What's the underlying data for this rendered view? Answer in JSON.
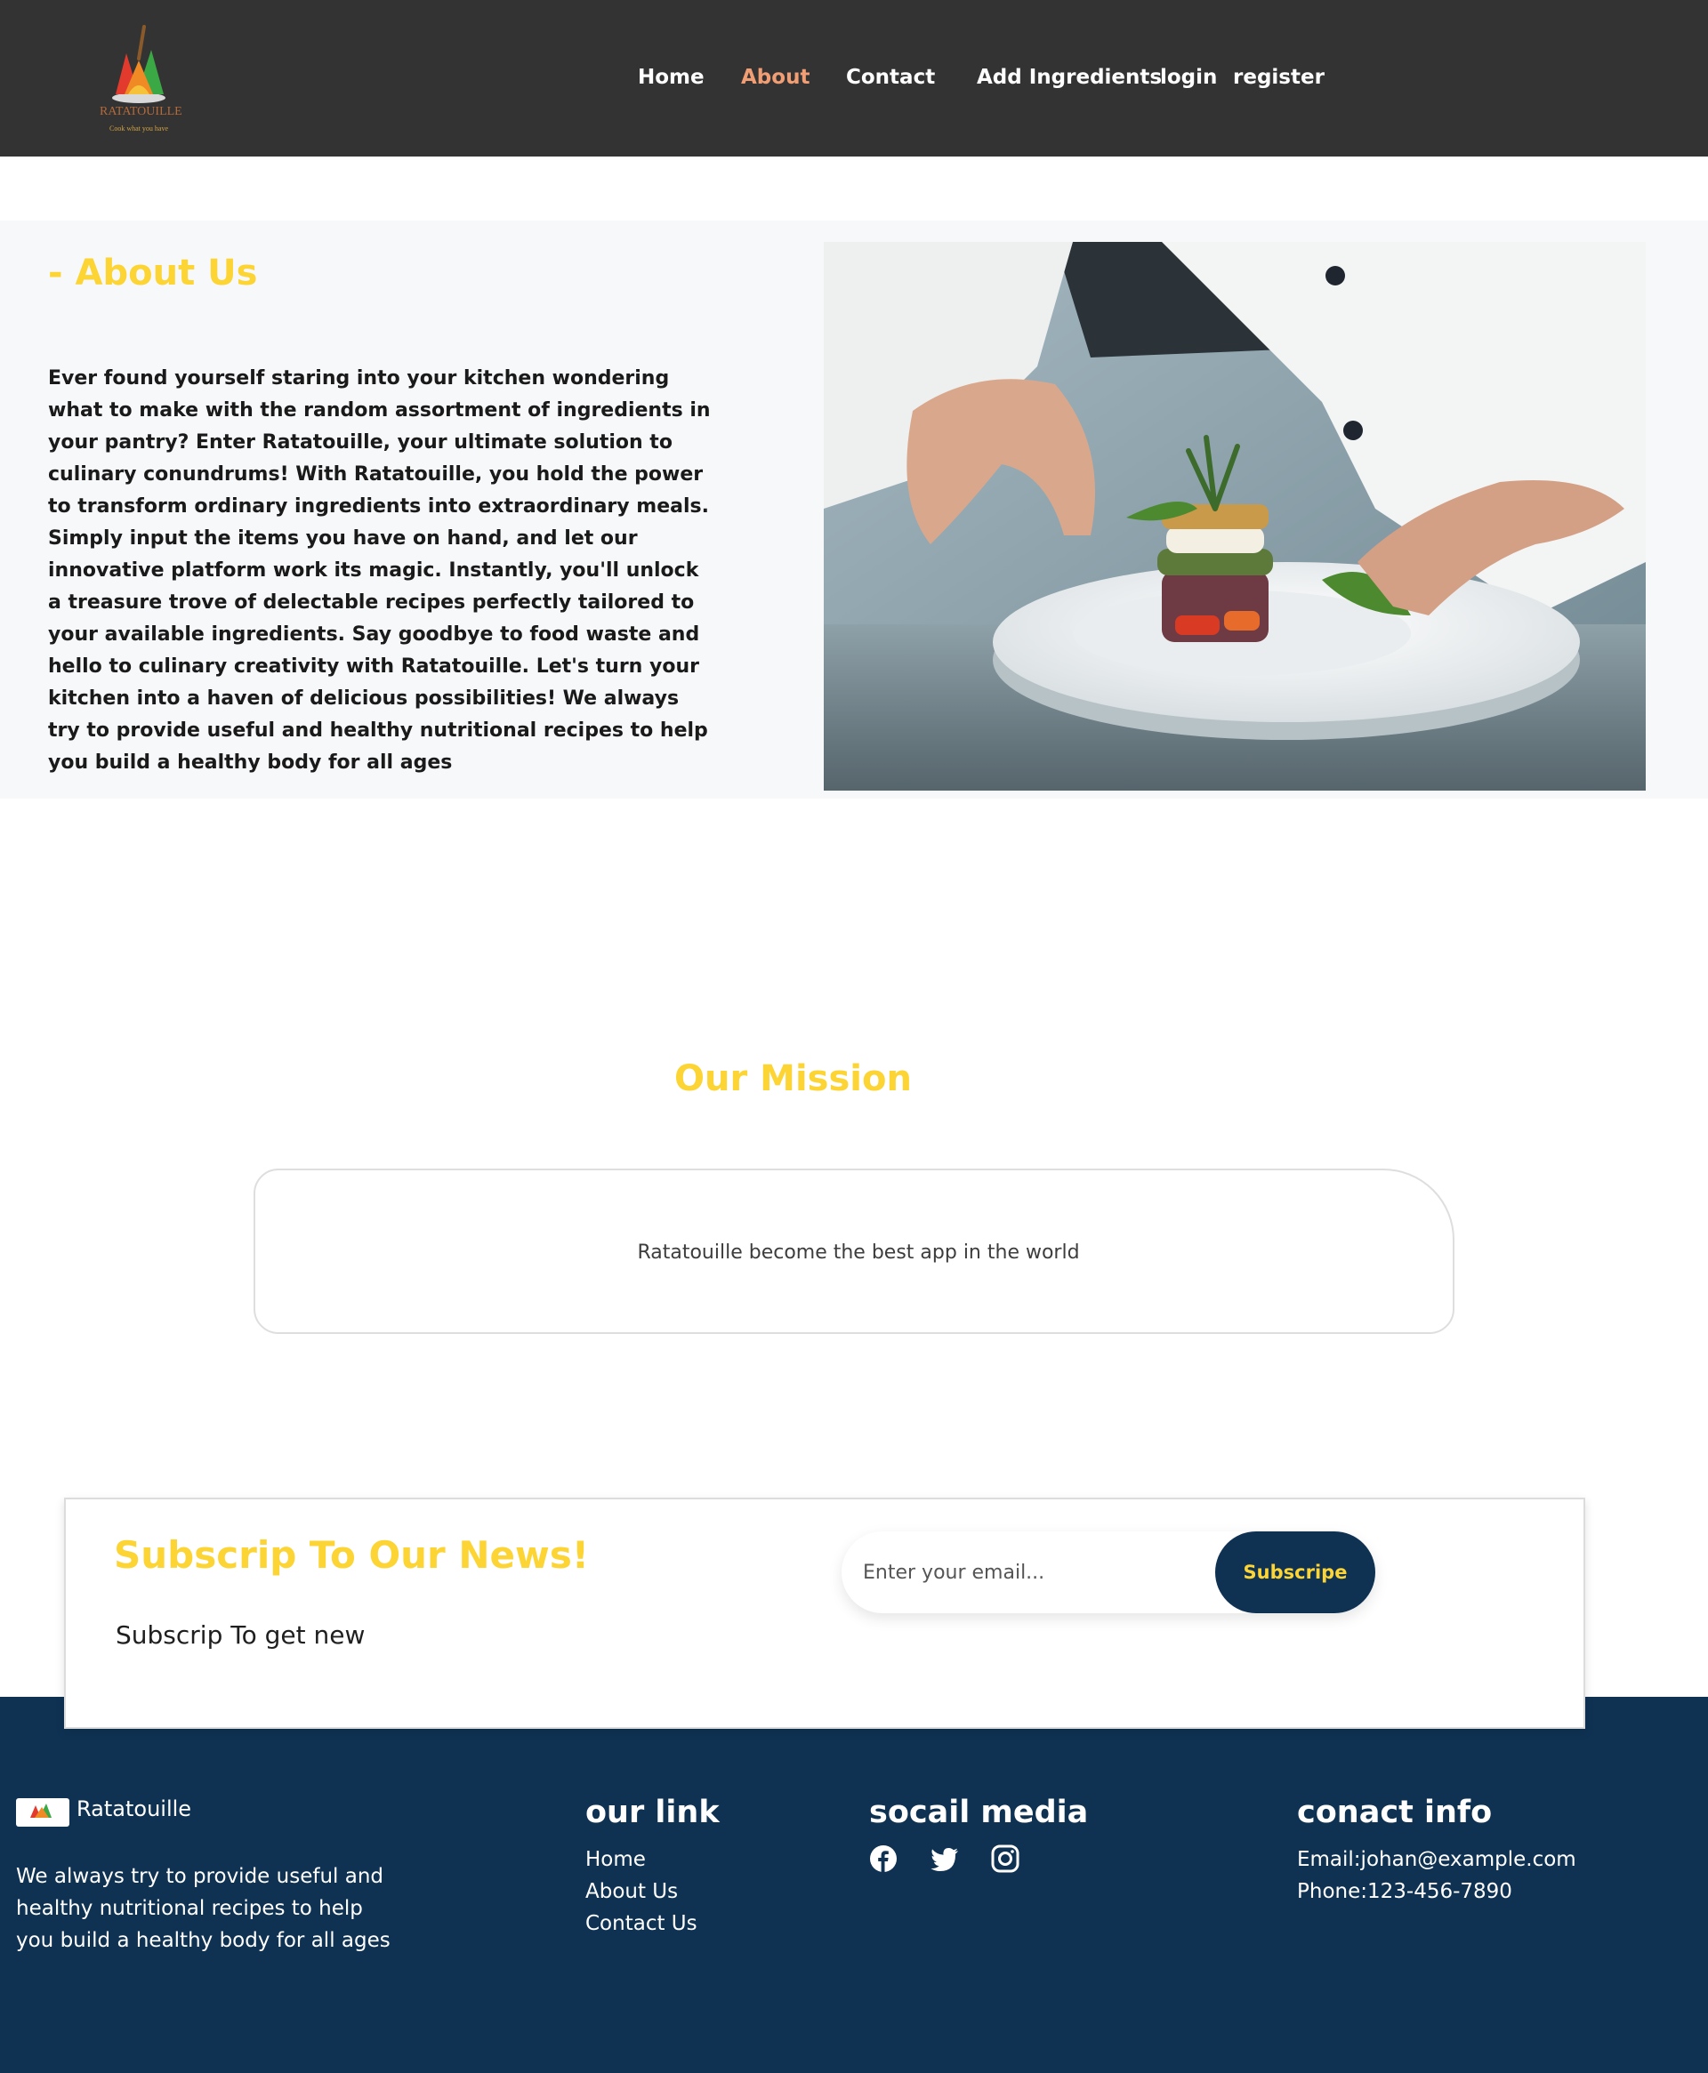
{
  "header": {
    "logo": {
      "name": "RATATOUILLE",
      "tagline": "Cook what you have",
      "icon": "vegetable-logo-icon"
    },
    "nav": [
      {
        "label": "Home",
        "active": false
      },
      {
        "label": "About",
        "active": true
      },
      {
        "label": "Contact",
        "active": false
      },
      {
        "label": "Add Ingredients",
        "active": false
      },
      {
        "label": "login",
        "active": false
      },
      {
        "label": "register",
        "active": false
      }
    ]
  },
  "about": {
    "title": "- About Us",
    "text": "Ever found yourself staring into your kitchen wondering what to make with the random assortment of ingredients in your pantry? Enter Ratatouille, your ultimate solution to culinary conundrums! With Ratatouille, you hold the power to transform ordinary ingredients into extraordinary meals. Simply input the items you have on hand, and let our innovative platform work its magic. Instantly, you'll unlock a treasure trove of delectable recipes perfectly tailored to your available ingredients. Say goodbye to food waste and hello to culinary creativity with Ratatouille. Let's turn your kitchen into a haven of delicious possibilities! We always try to provide useful and healthy nutritional recipes to help you build a healthy body for all ages",
    "image": "chef-plating-dish-photo"
  },
  "mission": {
    "title": "Our Mission",
    "text": "Ratatouille become the best app in the world"
  },
  "subscribe": {
    "title": "Subscrip To Our News!",
    "description": "Subscrip To get new",
    "email_placeholder": "Enter your email...",
    "button_label": "Subscripe"
  },
  "footer": {
    "brand": "Ratatouille",
    "description": "We always try to provide useful and healthy nutritional recipes to help you build a healthy body for all ages",
    "links_heading": "our link",
    "links": [
      "Home",
      "About Us",
      "Contact Us"
    ],
    "social_heading": "socail media",
    "social": [
      "facebook-icon",
      "twitter-icon",
      "instagram-icon"
    ],
    "contact_heading": "conact info",
    "email": "Email:johan@example.com",
    "phone": "Phone:123-456-7890"
  },
  "colors": {
    "navbar": "#333333",
    "accent_yellow": "#fcd434",
    "active_nav": "#f29e74",
    "footer_navy": "#0f3253",
    "about_bg": "#f7f8fa"
  }
}
